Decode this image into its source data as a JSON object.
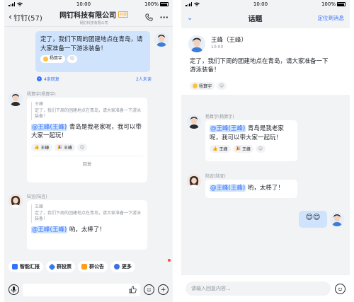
{
  "status": {
    "time": "10:00",
    "battery": "100%"
  },
  "left": {
    "back_label": "钉钉(57)",
    "title": "网钉科技有限公司",
    "external_tag": "外部",
    "subtitle": "网钉科技有限公司",
    "main_message": "定了，我们下周的团建地点在青岛，请大家准备一下游泳装备！",
    "main_reaction": "杨算宇",
    "replies_label": "4条回复",
    "unread_label": "2人未读",
    "msg1": {
      "sender": "杨算宇(杨算宇)",
      "quote_name": "王峰",
      "quote_text": "定了，我们下周的团建地点在青岛，请大家准备一下游泳装备！",
      "mention": "@王峰(王峰)",
      "text": " 青岛是我老家呢，我可以带大家一起玩！",
      "reaction1": "王峰",
      "reaction2": "王峰",
      "reply_label": "回复"
    },
    "msg2": {
      "sender": "陆宜(陆宜)",
      "quote_name": "王峰",
      "quote_text": "定了，我们下周的团建地点在青岛，请大家准备一下游泳装备！",
      "mention": "@王峰(王峰)",
      "text": " 哟，太棒了！"
    },
    "quick_actions": [
      "智能汇报",
      "群投票",
      "群公告",
      "更多"
    ],
    "colors": {
      "accent": "#3370ff",
      "bubble": "#cfe3fd"
    }
  },
  "right": {
    "header_title": "话题",
    "header_link": "定位到消息",
    "orig_name": "王峰（王峰）",
    "orig_time": "10:00",
    "orig_text": "定了，我们下周的团建地点在青岛，请大家准备一下游泳装备！",
    "orig_reaction": "杨算宇",
    "reply1": {
      "sender": "杨算宇(杨算宇)",
      "mention": "@王峰(王峰)",
      "text": " 青岛是我老家呢，我可以带大家一起玩！",
      "reaction1": "王峰",
      "reaction2": "王峰"
    },
    "reply2": {
      "sender": "陆宜(陆宜)",
      "mention": "@王峰(王峰)",
      "text": " 哟，太棒了！"
    },
    "my_reply": "😊😊",
    "input_placeholder": "请输入回复内容..."
  }
}
